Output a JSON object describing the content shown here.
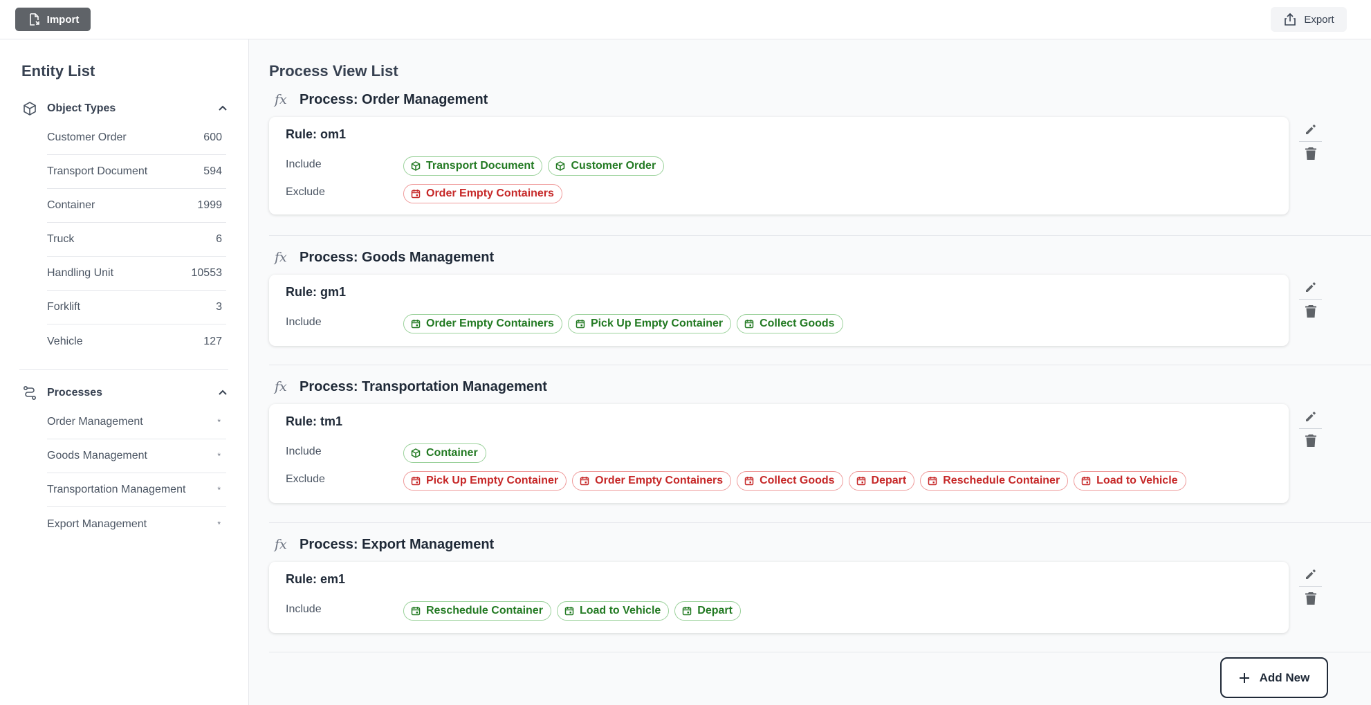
{
  "toolbar": {
    "import_label": "Import",
    "export_label": "Export"
  },
  "sidebar": {
    "title": "Entity List",
    "object_types": {
      "label": "Object Types",
      "items": [
        {
          "label": "Customer Order",
          "count": "600"
        },
        {
          "label": "Transport Document",
          "count": "594"
        },
        {
          "label": "Container",
          "count": "1999"
        },
        {
          "label": "Truck",
          "count": "6"
        },
        {
          "label": "Handling Unit",
          "count": "10553"
        },
        {
          "label": "Forklift",
          "count": "3"
        },
        {
          "label": "Vehicle",
          "count": "127"
        }
      ]
    },
    "processes": {
      "label": "Processes",
      "items": [
        {
          "label": "Order Management",
          "mark": "*"
        },
        {
          "label": "Goods Management",
          "mark": "*"
        },
        {
          "label": "Transportation Management",
          "mark": "*"
        },
        {
          "label": "Export Management",
          "mark": "*"
        }
      ]
    }
  },
  "main": {
    "title": "Process View List",
    "fx_symbol": "fx",
    "include_label": "Include",
    "exclude_label": "Exclude",
    "processes": [
      {
        "title": "Process: Order Management",
        "rule": "Rule: om1",
        "include": [
          {
            "icon": "cube-icon",
            "label": "Transport Document"
          },
          {
            "icon": "cube-icon",
            "label": "Customer Order"
          }
        ],
        "exclude": [
          {
            "icon": "calendar-icon",
            "label": "Order Empty Containers"
          }
        ]
      },
      {
        "title": "Process: Goods Management",
        "rule": "Rule: gm1",
        "include": [
          {
            "icon": "calendar-icon",
            "label": "Order Empty Containers"
          },
          {
            "icon": "calendar-icon",
            "label": "Pick Up Empty Container"
          },
          {
            "icon": "calendar-icon",
            "label": "Collect Goods"
          }
        ],
        "exclude": []
      },
      {
        "title": "Process: Transportation Management",
        "rule": "Rule: tm1",
        "include": [
          {
            "icon": "cube-icon",
            "label": "Container"
          }
        ],
        "exclude": [
          {
            "icon": "calendar-icon",
            "label": "Pick Up Empty Container"
          },
          {
            "icon": "calendar-icon",
            "label": "Order Empty Containers"
          },
          {
            "icon": "calendar-icon",
            "label": "Collect Goods"
          },
          {
            "icon": "calendar-icon",
            "label": "Depart"
          },
          {
            "icon": "calendar-icon",
            "label": "Reschedule Container"
          },
          {
            "icon": "calendar-icon",
            "label": "Load to Vehicle"
          }
        ]
      },
      {
        "title": "Process: Export Management",
        "rule": "Rule: em1",
        "include": [
          {
            "icon": "calendar-icon",
            "label": "Reschedule Container"
          },
          {
            "icon": "calendar-icon",
            "label": "Load to Vehicle"
          },
          {
            "icon": "calendar-icon",
            "label": "Depart"
          }
        ],
        "exclude": []
      }
    ],
    "add_label": "Add New"
  },
  "colors": {
    "include": "#237a23",
    "exclude": "#c62828",
    "import_bg": "#5f6368"
  }
}
